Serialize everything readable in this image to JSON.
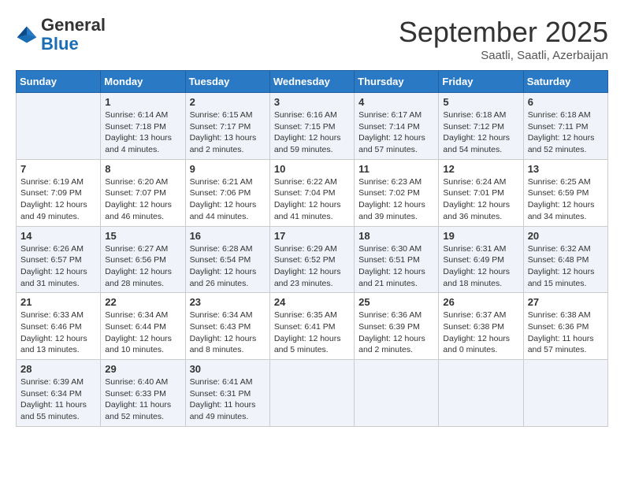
{
  "logo": {
    "text_general": "General",
    "text_blue": "Blue"
  },
  "header": {
    "month": "September 2025",
    "location": "Saatli, Saatli, Azerbaijan"
  },
  "days_of_week": [
    "Sunday",
    "Monday",
    "Tuesday",
    "Wednesday",
    "Thursday",
    "Friday",
    "Saturday"
  ],
  "weeks": [
    [
      {
        "day": "",
        "sunrise": "",
        "sunset": "",
        "daylight": ""
      },
      {
        "day": "1",
        "sunrise": "Sunrise: 6:14 AM",
        "sunset": "Sunset: 7:18 PM",
        "daylight": "Daylight: 13 hours and 4 minutes."
      },
      {
        "day": "2",
        "sunrise": "Sunrise: 6:15 AM",
        "sunset": "Sunset: 7:17 PM",
        "daylight": "Daylight: 13 hours and 2 minutes."
      },
      {
        "day": "3",
        "sunrise": "Sunrise: 6:16 AM",
        "sunset": "Sunset: 7:15 PM",
        "daylight": "Daylight: 12 hours and 59 minutes."
      },
      {
        "day": "4",
        "sunrise": "Sunrise: 6:17 AM",
        "sunset": "Sunset: 7:14 PM",
        "daylight": "Daylight: 12 hours and 57 minutes."
      },
      {
        "day": "5",
        "sunrise": "Sunrise: 6:18 AM",
        "sunset": "Sunset: 7:12 PM",
        "daylight": "Daylight: 12 hours and 54 minutes."
      },
      {
        "day": "6",
        "sunrise": "Sunrise: 6:18 AM",
        "sunset": "Sunset: 7:11 PM",
        "daylight": "Daylight: 12 hours and 52 minutes."
      }
    ],
    [
      {
        "day": "7",
        "sunrise": "Sunrise: 6:19 AM",
        "sunset": "Sunset: 7:09 PM",
        "daylight": "Daylight: 12 hours and 49 minutes."
      },
      {
        "day": "8",
        "sunrise": "Sunrise: 6:20 AM",
        "sunset": "Sunset: 7:07 PM",
        "daylight": "Daylight: 12 hours and 46 minutes."
      },
      {
        "day": "9",
        "sunrise": "Sunrise: 6:21 AM",
        "sunset": "Sunset: 7:06 PM",
        "daylight": "Daylight: 12 hours and 44 minutes."
      },
      {
        "day": "10",
        "sunrise": "Sunrise: 6:22 AM",
        "sunset": "Sunset: 7:04 PM",
        "daylight": "Daylight: 12 hours and 41 minutes."
      },
      {
        "day": "11",
        "sunrise": "Sunrise: 6:23 AM",
        "sunset": "Sunset: 7:02 PM",
        "daylight": "Daylight: 12 hours and 39 minutes."
      },
      {
        "day": "12",
        "sunrise": "Sunrise: 6:24 AM",
        "sunset": "Sunset: 7:01 PM",
        "daylight": "Daylight: 12 hours and 36 minutes."
      },
      {
        "day": "13",
        "sunrise": "Sunrise: 6:25 AM",
        "sunset": "Sunset: 6:59 PM",
        "daylight": "Daylight: 12 hours and 34 minutes."
      }
    ],
    [
      {
        "day": "14",
        "sunrise": "Sunrise: 6:26 AM",
        "sunset": "Sunset: 6:57 PM",
        "daylight": "Daylight: 12 hours and 31 minutes."
      },
      {
        "day": "15",
        "sunrise": "Sunrise: 6:27 AM",
        "sunset": "Sunset: 6:56 PM",
        "daylight": "Daylight: 12 hours and 28 minutes."
      },
      {
        "day": "16",
        "sunrise": "Sunrise: 6:28 AM",
        "sunset": "Sunset: 6:54 PM",
        "daylight": "Daylight: 12 hours and 26 minutes."
      },
      {
        "day": "17",
        "sunrise": "Sunrise: 6:29 AM",
        "sunset": "Sunset: 6:52 PM",
        "daylight": "Daylight: 12 hours and 23 minutes."
      },
      {
        "day": "18",
        "sunrise": "Sunrise: 6:30 AM",
        "sunset": "Sunset: 6:51 PM",
        "daylight": "Daylight: 12 hours and 21 minutes."
      },
      {
        "day": "19",
        "sunrise": "Sunrise: 6:31 AM",
        "sunset": "Sunset: 6:49 PM",
        "daylight": "Daylight: 12 hours and 18 minutes."
      },
      {
        "day": "20",
        "sunrise": "Sunrise: 6:32 AM",
        "sunset": "Sunset: 6:48 PM",
        "daylight": "Daylight: 12 hours and 15 minutes."
      }
    ],
    [
      {
        "day": "21",
        "sunrise": "Sunrise: 6:33 AM",
        "sunset": "Sunset: 6:46 PM",
        "daylight": "Daylight: 12 hours and 13 minutes."
      },
      {
        "day": "22",
        "sunrise": "Sunrise: 6:34 AM",
        "sunset": "Sunset: 6:44 PM",
        "daylight": "Daylight: 12 hours and 10 minutes."
      },
      {
        "day": "23",
        "sunrise": "Sunrise: 6:34 AM",
        "sunset": "Sunset: 6:43 PM",
        "daylight": "Daylight: 12 hours and 8 minutes."
      },
      {
        "day": "24",
        "sunrise": "Sunrise: 6:35 AM",
        "sunset": "Sunset: 6:41 PM",
        "daylight": "Daylight: 12 hours and 5 minutes."
      },
      {
        "day": "25",
        "sunrise": "Sunrise: 6:36 AM",
        "sunset": "Sunset: 6:39 PM",
        "daylight": "Daylight: 12 hours and 2 minutes."
      },
      {
        "day": "26",
        "sunrise": "Sunrise: 6:37 AM",
        "sunset": "Sunset: 6:38 PM",
        "daylight": "Daylight: 12 hours and 0 minutes."
      },
      {
        "day": "27",
        "sunrise": "Sunrise: 6:38 AM",
        "sunset": "Sunset: 6:36 PM",
        "daylight": "Daylight: 11 hours and 57 minutes."
      }
    ],
    [
      {
        "day": "28",
        "sunrise": "Sunrise: 6:39 AM",
        "sunset": "Sunset: 6:34 PM",
        "daylight": "Daylight: 11 hours and 55 minutes."
      },
      {
        "day": "29",
        "sunrise": "Sunrise: 6:40 AM",
        "sunset": "Sunset: 6:33 PM",
        "daylight": "Daylight: 11 hours and 52 minutes."
      },
      {
        "day": "30",
        "sunrise": "Sunrise: 6:41 AM",
        "sunset": "Sunset: 6:31 PM",
        "daylight": "Daylight: 11 hours and 49 minutes."
      },
      {
        "day": "",
        "sunrise": "",
        "sunset": "",
        "daylight": ""
      },
      {
        "day": "",
        "sunrise": "",
        "sunset": "",
        "daylight": ""
      },
      {
        "day": "",
        "sunrise": "",
        "sunset": "",
        "daylight": ""
      },
      {
        "day": "",
        "sunrise": "",
        "sunset": "",
        "daylight": ""
      }
    ]
  ]
}
